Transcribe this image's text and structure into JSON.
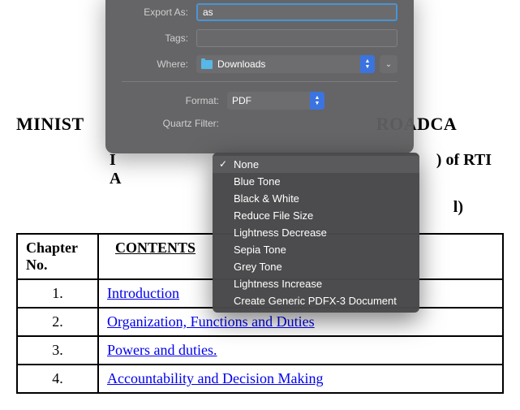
{
  "document": {
    "title_visible": "MINISTRY OF INFORMATION AND BROADCASTING",
    "subtitle_right": ") of RTI A",
    "subtitle_right2": "l)",
    "table": {
      "header_chapter": "Chapter No.",
      "header_contents": "CONTENTS",
      "rows": [
        {
          "num": "1.",
          "title": "Introduction"
        },
        {
          "num": "2.",
          "title": "Organization, Functions and Duties"
        },
        {
          "num": "3.",
          "title": "Powers and duties."
        },
        {
          "num": "4.",
          "title": "Accountability and Decision Making"
        }
      ]
    }
  },
  "dialog": {
    "export_as_label": "Export As:",
    "export_as_value": "as",
    "tags_label": "Tags:",
    "where_label": "Where:",
    "where_value": "Downloads",
    "format_label": "Format:",
    "format_value": "PDF",
    "quartz_label": "Quartz Filter:"
  },
  "quartz_menu": {
    "items": [
      {
        "label": "None",
        "selected": true
      },
      {
        "label": "Blue Tone",
        "selected": false
      },
      {
        "label": "Black & White",
        "selected": false
      },
      {
        "label": "Reduce File Size",
        "selected": false
      },
      {
        "label": "Lightness Decrease",
        "selected": false
      },
      {
        "label": "Sepia Tone",
        "selected": false
      },
      {
        "label": "Grey Tone",
        "selected": false
      },
      {
        "label": "Lightness Increase",
        "selected": false
      },
      {
        "label": "Create Generic PDFX-3 Document",
        "selected": false
      }
    ]
  }
}
